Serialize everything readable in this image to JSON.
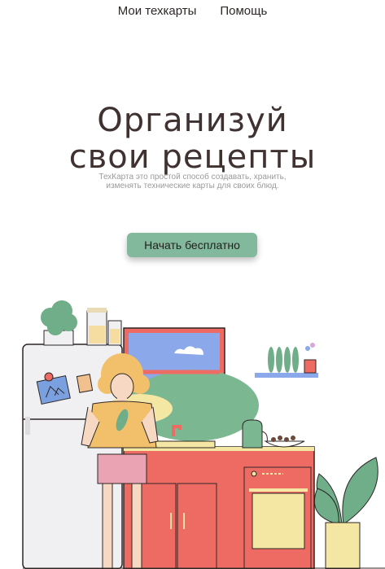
{
  "nav": {
    "items": [
      {
        "label": "Мои техкарты"
      },
      {
        "label": "Помощь"
      }
    ]
  },
  "hero": {
    "title_line1": "Организуй",
    "title_line2": "свои рецепты",
    "subtitle": "ТехКарта это простой способ создавать, хранить, изменять технические карты для своих блюд.",
    "cta_label": "Начать бесплатно"
  },
  "colors": {
    "accent": "#82b89b",
    "cabinet": "#ee6b63",
    "text": "#3f3231"
  }
}
